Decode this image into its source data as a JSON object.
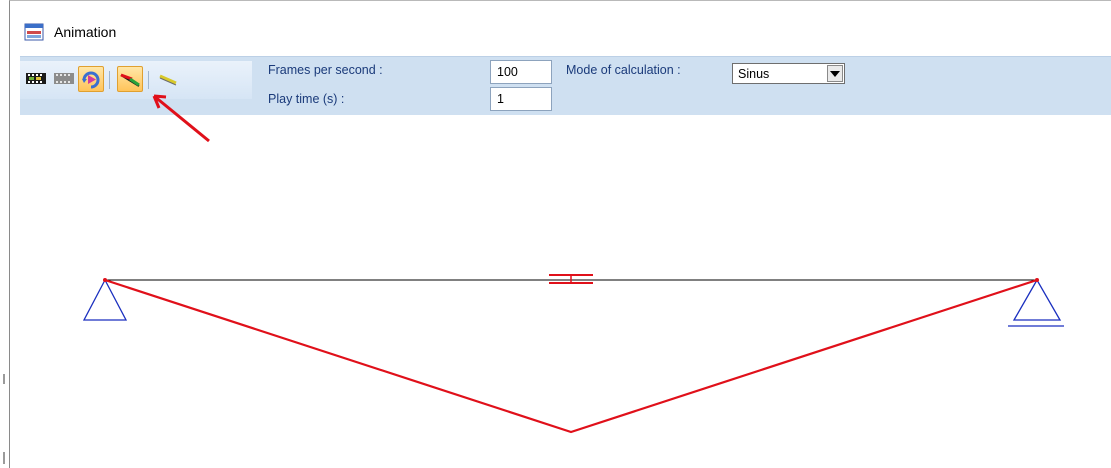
{
  "window": {
    "title": "Animation",
    "title_icon": "animation-window-icon"
  },
  "toolbar": {
    "buttons": [
      {
        "name": "film-strip-icon",
        "active": false
      },
      {
        "name": "film-strip-disabled-icon",
        "active": false
      },
      {
        "name": "loop-play-icon",
        "active": true
      },
      {
        "name": "deformed-beam-icon",
        "active": true
      },
      {
        "name": "beam-line-icon",
        "active": false
      }
    ],
    "frames_per_second_label": "Frames per second :",
    "frames_per_second_value": "100",
    "play_time_label": "Play time (s) :",
    "play_time_value": "1",
    "mode_label": "Mode of calculation :",
    "mode_value": "Sinus"
  },
  "colors": {
    "toolbar_bg": "#cfe0f1",
    "beam": "#000000",
    "deformation": "#e0101a",
    "support": "#1a2fbf",
    "label_text": "#1a3a7a",
    "annotation_arrow": "#e0101a"
  }
}
